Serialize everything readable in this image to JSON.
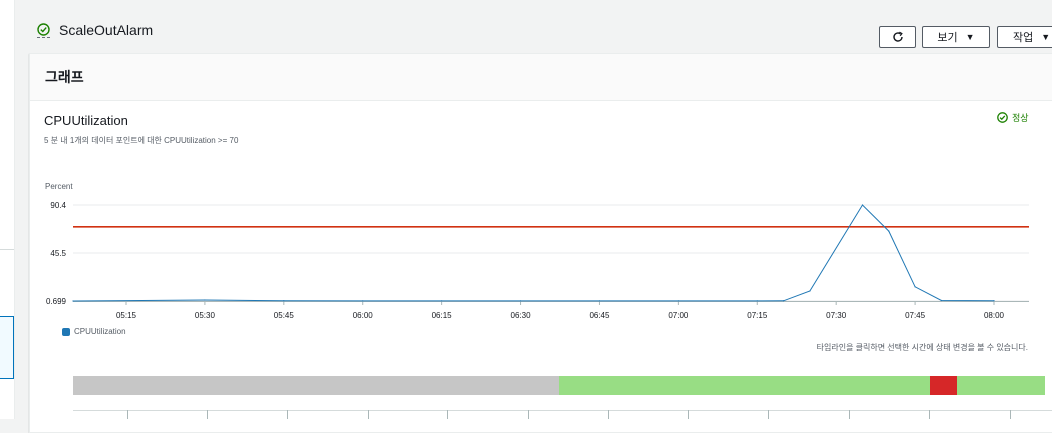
{
  "alarm": {
    "name": "ScaleOutAlarm",
    "status_icon": "check-circle-icon"
  },
  "toolbar": {
    "refresh_icon": "refresh-icon",
    "view_label": "보기",
    "actions_label": "작업"
  },
  "panel": {
    "title": "그래프",
    "metric_name": "CPUUtilization",
    "description": "5 분 내 1개의 데이터 포인트에 대한 CPUUtilization >= 70",
    "state_label": "정상",
    "timeline_hint": "타임라인을 클릭하면 선택한 시간에 상태 변경을 볼 수 있습니다."
  },
  "colors": {
    "series": "#1f77b4",
    "threshold": "#d13212",
    "ok": "#1d8102",
    "timeline_insufficient": "#c6c6c6",
    "timeline_ok": "#98dd84",
    "timeline_alarm": "#d62728"
  },
  "chart_data": {
    "type": "line",
    "ylabel": "Percent",
    "y_ticks": [
      "0.699",
      "45.5",
      "90.4"
    ],
    "ylim": [
      0.699,
      90.4
    ],
    "x_ticks": [
      "05:15",
      "05:30",
      "05:45",
      "06:00",
      "06:15",
      "06:30",
      "06:45",
      "07:00",
      "07:15",
      "07:30",
      "07:45",
      "08:00"
    ],
    "threshold": 70,
    "series": [
      {
        "name": "CPUUtilization",
        "points": [
          [
            "05:05",
            0.699
          ],
          [
            "05:30",
            1.6
          ],
          [
            "05:45",
            0.9
          ],
          [
            "06:00",
            0.8
          ],
          [
            "06:15",
            0.8
          ],
          [
            "06:30",
            0.8
          ],
          [
            "06:45",
            0.8
          ],
          [
            "07:00",
            0.8
          ],
          [
            "07:15",
            0.8
          ],
          [
            "07:20",
            0.9
          ],
          [
            "07:25",
            10
          ],
          [
            "07:35",
            90.4
          ],
          [
            "07:40",
            66
          ],
          [
            "07:45",
            14
          ],
          [
            "07:50",
            1.2
          ],
          [
            "08:00",
            1.0
          ]
        ]
      }
    ],
    "grid": true,
    "legend": "bottom-left"
  },
  "timeline": [
    {
      "state": "insufficient_data",
      "fraction": 0.4995
    },
    {
      "state": "ok",
      "fraction": 0.3817
    },
    {
      "state": "alarm",
      "fraction": 0.0278
    },
    {
      "state": "ok",
      "fraction": 0.091
    }
  ]
}
